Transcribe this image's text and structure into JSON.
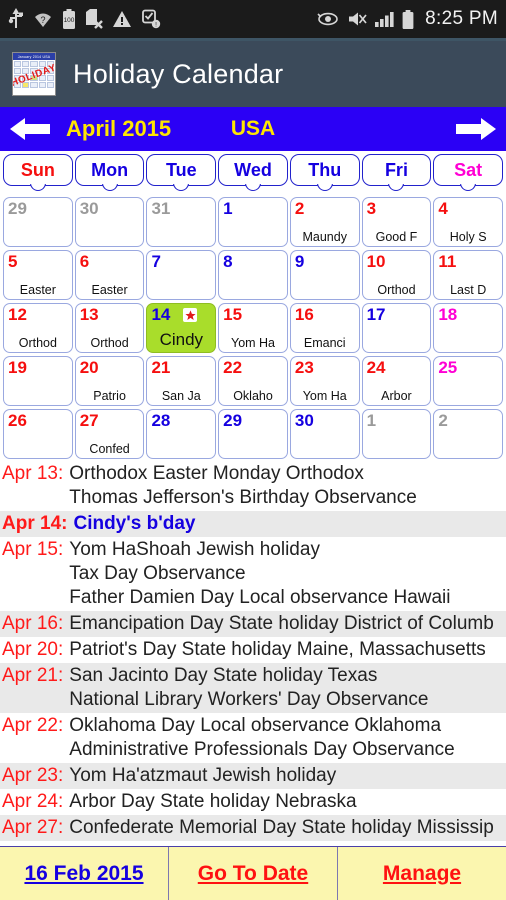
{
  "status_bar": {
    "left_icons": [
      "usb-icon",
      "wifi-question-icon",
      "battery-100-icon",
      "sdcard-error-icon",
      "warning-icon",
      "alarm-alert-icon"
    ],
    "right_icons": [
      "smart-stay-eye-icon",
      "sound-mute-icon",
      "signal-bars-icon",
      "battery-icon"
    ],
    "battery_level": "100",
    "time": "8:25 PM"
  },
  "appbar": {
    "title": "Holiday Calendar",
    "icon_name": "holiday-calendar-app-icon",
    "icon_header": "January 2014  USA",
    "icon_overlay_text": "HOLIDAYS"
  },
  "monthnav": {
    "prev_label": "prev-month-arrow",
    "month": "April 2015",
    "country": "USA",
    "next_label": "next-month-arrow",
    "bg_color": "#2b00f5",
    "text_color": "#ffe600"
  },
  "weekdays": [
    {
      "label": "Sun",
      "color": "#f50f0f"
    },
    {
      "label": "Mon",
      "color": "#1500e0"
    },
    {
      "label": "Tue",
      "color": "#1500e0"
    },
    {
      "label": "Wed",
      "color": "#1500e0"
    },
    {
      "label": "Thu",
      "color": "#1500e0"
    },
    {
      "label": "Fri",
      "color": "#1500e0"
    },
    {
      "label": "Sat",
      "color": "#ff00d4"
    }
  ],
  "calendar": {
    "rows": [
      [
        {
          "num": "29",
          "tone": "gray",
          "label": ""
        },
        {
          "num": "30",
          "tone": "gray",
          "label": ""
        },
        {
          "num": "31",
          "tone": "gray",
          "label": ""
        },
        {
          "num": "1",
          "tone": "blue",
          "label": ""
        },
        {
          "num": "2",
          "tone": "red",
          "label": "Maundy"
        },
        {
          "num": "3",
          "tone": "red",
          "label": "Good F"
        },
        {
          "num": "4",
          "tone": "red",
          "label": "Holy S"
        }
      ],
      [
        {
          "num": "5",
          "tone": "red",
          "label": "Easter"
        },
        {
          "num": "6",
          "tone": "red",
          "label": "Easter"
        },
        {
          "num": "7",
          "tone": "blue",
          "label": ""
        },
        {
          "num": "8",
          "tone": "blue",
          "label": ""
        },
        {
          "num": "9",
          "tone": "blue",
          "label": ""
        },
        {
          "num": "10",
          "tone": "red",
          "label": "Orthod"
        },
        {
          "num": "11",
          "tone": "red",
          "label": "Last D"
        }
      ],
      [
        {
          "num": "12",
          "tone": "red",
          "label": "Orthod"
        },
        {
          "num": "13",
          "tone": "red",
          "label": "Orthod"
        },
        {
          "num": "14",
          "tone": "blue",
          "label": "Cindy",
          "today": true,
          "star": true
        },
        {
          "num": "15",
          "tone": "red",
          "label": "Yom Ha"
        },
        {
          "num": "16",
          "tone": "red",
          "label": "Emanci"
        },
        {
          "num": "17",
          "tone": "blue",
          "label": ""
        },
        {
          "num": "18",
          "tone": "magenta",
          "label": ""
        }
      ],
      [
        {
          "num": "19",
          "tone": "red",
          "label": ""
        },
        {
          "num": "20",
          "tone": "red",
          "label": "Patrio"
        },
        {
          "num": "21",
          "tone": "red",
          "label": "San Ja"
        },
        {
          "num": "22",
          "tone": "red",
          "label": "Oklaho"
        },
        {
          "num": "23",
          "tone": "red",
          "label": "Yom Ha"
        },
        {
          "num": "24",
          "tone": "red",
          "label": "Arbor"
        },
        {
          "num": "25",
          "tone": "magenta",
          "label": ""
        }
      ],
      [
        {
          "num": "26",
          "tone": "red",
          "label": ""
        },
        {
          "num": "27",
          "tone": "red",
          "label": "Confed"
        },
        {
          "num": "28",
          "tone": "blue",
          "label": ""
        },
        {
          "num": "29",
          "tone": "blue",
          "label": ""
        },
        {
          "num": "30",
          "tone": "blue",
          "label": ""
        },
        {
          "num": "1",
          "tone": "gray",
          "label": ""
        },
        {
          "num": "2",
          "tone": "gray",
          "label": ""
        }
      ]
    ]
  },
  "events": [
    {
      "date": "Apr 13:",
      "lines": [
        "Orthodox Easter Monday Orthodox",
        "Thomas Jefferson's Birthday Observance"
      ],
      "alt": false,
      "highlight": false
    },
    {
      "date": "Apr 14:",
      "lines": [
        "Cindy's b'day"
      ],
      "alt": true,
      "highlight": true
    },
    {
      "date": "Apr 15:",
      "lines": [
        "Yom HaShoah Jewish holiday",
        "Tax Day Observance",
        "Father Damien Day Local observance Hawaii"
      ],
      "alt": false,
      "highlight": false
    },
    {
      "date": "Apr 16:",
      "lines": [
        "Emancipation Day State holiday District of Columb"
      ],
      "alt": true,
      "highlight": false
    },
    {
      "date": "Apr 20:",
      "lines": [
        "Patriot's Day State holiday Maine, Massachusetts"
      ],
      "alt": false,
      "highlight": false
    },
    {
      "date": "Apr 21:",
      "lines": [
        "San Jacinto Day State holiday Texas",
        "National Library Workers' Day Observance"
      ],
      "alt": true,
      "highlight": false
    },
    {
      "date": "Apr 22:",
      "lines": [
        "Oklahoma Day Local observance Oklahoma",
        "Administrative Professionals Day Observance"
      ],
      "alt": false,
      "highlight": false
    },
    {
      "date": "Apr 23:",
      "lines": [
        "Yom Ha'atzmaut Jewish holiday"
      ],
      "alt": true,
      "highlight": false
    },
    {
      "date": "Apr 24:",
      "lines": [
        "Arbor Day State holiday Nebraska"
      ],
      "alt": false,
      "highlight": false
    },
    {
      "date": "Apr 27:",
      "lines": [
        "Confederate Memorial Day State holiday Mississip"
      ],
      "alt": true,
      "highlight": false
    }
  ],
  "footer": {
    "buttons": [
      {
        "label": "16 Feb 2015",
        "color": "#1500e0",
        "name": "current-date-button"
      },
      {
        "label": "Go To Date",
        "color": "#ff1111",
        "name": "go-to-date-button"
      },
      {
        "label": "Manage",
        "color": "#ff1111",
        "name": "manage-button"
      }
    ],
    "bg_color": "#fbf6af"
  }
}
